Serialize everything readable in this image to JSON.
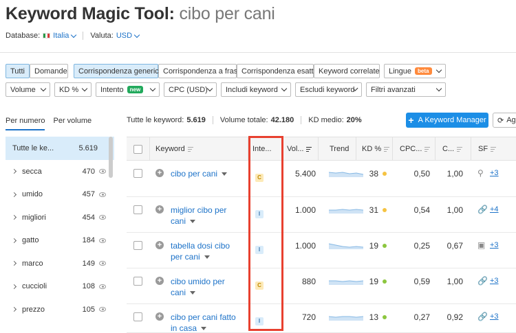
{
  "header": {
    "title": "Keyword Magic Tool:",
    "keyword": "cibo per cani",
    "database_label": "Database:",
    "database_value": "Italia",
    "currency_label": "Valuta:",
    "currency_value": "USD"
  },
  "match_tabs": [
    "Tutti",
    "Domande",
    "Corrispondenza generica",
    "Corrispondenza a frase",
    "Corrispondenza esatta",
    "Keyword correlate"
  ],
  "languages": {
    "label": "Lingue",
    "badge": "beta"
  },
  "filters": {
    "volume": "Volume",
    "kd": "KD %",
    "intent": "Intento",
    "intent_badge": "new",
    "cpc": "CPC (USD)",
    "include": "Includi keyword",
    "exclude": "Escludi keyword",
    "advanced": "Filtri avanzati"
  },
  "view_tabs": {
    "by_number": "Per numero",
    "by_volume": "Per volume"
  },
  "summary": {
    "all_label": "Tutte le keyword:",
    "all_value": "5.619",
    "volume_label": "Volume totale:",
    "volume_value": "42.180",
    "kd_label": "KD medio:",
    "kd_value": "20%"
  },
  "buttons": {
    "keyword_manager": "A Keyword Manager",
    "ag": "Ag"
  },
  "sidebar": {
    "head": {
      "label": "Tutte le ke...",
      "count": "5.619"
    },
    "items": [
      {
        "label": "secca",
        "count": "470"
      },
      {
        "label": "umido",
        "count": "457"
      },
      {
        "label": "migliori",
        "count": "454"
      },
      {
        "label": "gatto",
        "count": "184"
      },
      {
        "label": "marco",
        "count": "149"
      },
      {
        "label": "cuccioli",
        "count": "108"
      },
      {
        "label": "prezzo",
        "count": "105"
      }
    ]
  },
  "table": {
    "columns": [
      "Keyword",
      "Inte...",
      "Vol...",
      "Trend",
      "KD %",
      "CPC...",
      "C...",
      "SF"
    ],
    "rows": [
      {
        "kw1": "cibo per cani",
        "kw2": "",
        "intent": "C",
        "volume": "5.400",
        "kd": "38",
        "kd_color": "#f5c342",
        "cpc": "0,50",
        "com": "1,00",
        "sf_icon": "location-pin-icon",
        "sf_glyph": "⚲",
        "sf_more": "+3"
      },
      {
        "kw1": "miglior cibo per",
        "kw2": "cani",
        "intent": "I",
        "volume": "1.000",
        "kd": "31",
        "kd_color": "#f5c342",
        "cpc": "0,54",
        "com": "1,00",
        "sf_icon": "link-icon",
        "sf_glyph": "🔗",
        "sf_more": "+4"
      },
      {
        "kw1": "tabella dosi cibo",
        "kw2": "per cani",
        "intent": "I",
        "volume": "1.000",
        "kd": "19",
        "kd_color": "#8cc63f",
        "cpc": "0,25",
        "com": "0,67",
        "sf_icon": "image-icon",
        "sf_glyph": "▣",
        "sf_more": "+3"
      },
      {
        "kw1": "cibo umido per",
        "kw2": "cani",
        "intent": "C",
        "volume": "880",
        "kd": "19",
        "kd_color": "#8cc63f",
        "cpc": "0,59",
        "com": "1,00",
        "sf_icon": "link-icon",
        "sf_glyph": "🔗",
        "sf_more": "+3"
      },
      {
        "kw1": "cibo per cani fatto",
        "kw2": "in casa",
        "intent": "I",
        "volume": "720",
        "kd": "13",
        "kd_color": "#8cc63f",
        "cpc": "0,27",
        "com": "0,92",
        "sf_icon": "link-icon",
        "sf_glyph": "🔗",
        "sf_more": "+3"
      }
    ]
  }
}
